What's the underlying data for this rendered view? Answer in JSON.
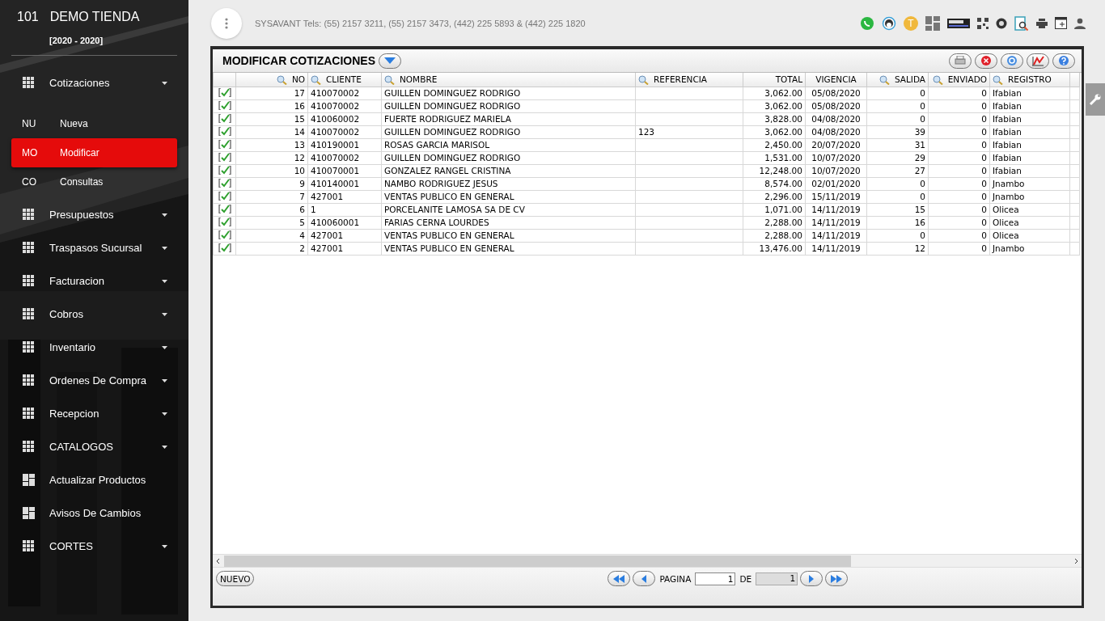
{
  "sidebar": {
    "store_number": "101",
    "store_name": "DEMO TIENDA",
    "period": "[2020 - 2020]",
    "items": [
      {
        "label": "Cotizaciones",
        "kind": "group",
        "children": [
          {
            "abbr": "NU",
            "label": "Nueva",
            "selected": false
          },
          {
            "abbr": "MO",
            "label": "Modificar",
            "selected": true
          },
          {
            "abbr": "CO",
            "label": "Consultas",
            "selected": false
          }
        ]
      },
      {
        "label": "Presupuestos",
        "kind": "group"
      },
      {
        "label": "Traspasos Sucursal",
        "kind": "group"
      },
      {
        "label": "Facturacion",
        "kind": "group"
      },
      {
        "label": "Cobros",
        "kind": "group"
      },
      {
        "label": "Inventario",
        "kind": "group"
      },
      {
        "label": "Ordenes De Compra",
        "kind": "group"
      },
      {
        "label": "Recepcion",
        "kind": "group"
      },
      {
        "label": "CATALOGOS",
        "kind": "group"
      },
      {
        "label": "Actualizar Productos",
        "kind": "link"
      },
      {
        "label": "Avisos De Cambios",
        "kind": "link"
      },
      {
        "label": "CORTES",
        "kind": "group"
      }
    ]
  },
  "topbar": {
    "contact": "SYSAVANT Tels: (55) 2157 3211, (55) 2157 3473, (442) 225 5893 & (442) 225 1820",
    "user_initial": "T"
  },
  "window": {
    "title": "MODIFICAR COTIZACIONES",
    "table": {
      "columns": [
        {
          "label": "NO",
          "filter": true,
          "kind": "number"
        },
        {
          "label": "CLIENTE",
          "filter": true,
          "kind": "text"
        },
        {
          "label": "NOMBRE",
          "filter": true,
          "kind": "text"
        },
        {
          "label": "REFERENCIA",
          "filter": true,
          "kind": "text"
        },
        {
          "label": "TOTAL",
          "filter": false,
          "kind": "number"
        },
        {
          "label": "VIGENCIA",
          "filter": false,
          "kind": "date"
        },
        {
          "label": "SALIDA",
          "filter": true,
          "kind": "number"
        },
        {
          "label": "ENVIADO",
          "filter": true,
          "kind": "number"
        },
        {
          "label": "REGISTRO",
          "filter": true,
          "kind": "text"
        }
      ],
      "rows": [
        {
          "checked": true,
          "cells": [
            "17",
            "410070002",
            "GUILLEN DOMINGUEZ RODRIGO",
            "",
            "3,062.00",
            "05/08/2020",
            "0",
            "0",
            "Ifabian"
          ]
        },
        {
          "checked": true,
          "cells": [
            "16",
            "410070002",
            "GUILLEN DOMINGUEZ RODRIGO",
            "",
            "3,062.00",
            "05/08/2020",
            "0",
            "0",
            "Ifabian"
          ]
        },
        {
          "checked": true,
          "cells": [
            "15",
            "410060002",
            "FUERTE RODRIGUEZ MARIELA",
            "",
            "3,828.00",
            "04/08/2020",
            "0",
            "0",
            "Ifabian"
          ]
        },
        {
          "checked": true,
          "cells": [
            "14",
            "410070002",
            "GUILLEN DOMINGUEZ RODRIGO",
            "123",
            "3,062.00",
            "04/08/2020",
            "39",
            "0",
            "Ifabian"
          ]
        },
        {
          "checked": true,
          "cells": [
            "13",
            "410190001",
            "ROSAS GARCIA MARISOL",
            "",
            "2,450.00",
            "20/07/2020",
            "31",
            "0",
            "Ifabian"
          ]
        },
        {
          "checked": true,
          "cells": [
            "12",
            "410070002",
            "GUILLEN DOMINGUEZ RODRIGO",
            "",
            "1,531.00",
            "10/07/2020",
            "29",
            "0",
            "Ifabian"
          ]
        },
        {
          "checked": true,
          "cells": [
            "10",
            "410070001",
            "GONZALEZ RANGEL CRISTINA",
            "",
            "12,248.00",
            "10/07/2020",
            "27",
            "0",
            "Ifabian"
          ]
        },
        {
          "checked": true,
          "cells": [
            "9",
            "410140001",
            "NAMBO RODRIGUEZ JESUS",
            "",
            "8,574.00",
            "02/01/2020",
            "0",
            "0",
            "Jnambo"
          ]
        },
        {
          "checked": true,
          "cells": [
            "7",
            "427001",
            "VENTAS PUBLICO EN GENERAL",
            "",
            "2,296.00",
            "15/11/2019",
            "0",
            "0",
            "Jnambo"
          ]
        },
        {
          "checked": true,
          "cells": [
            "6",
            "1",
            "PORCELANITE LAMOSA SA DE CV",
            "",
            "1,071.00",
            "14/11/2019",
            "15",
            "0",
            "Olicea"
          ]
        },
        {
          "checked": true,
          "cells": [
            "5",
            "410060001",
            "FARIAS CERNA LOURDES",
            "",
            "2,288.00",
            "14/11/2019",
            "16",
            "0",
            "Olicea"
          ]
        },
        {
          "checked": true,
          "cells": [
            "4",
            "427001",
            "VENTAS PUBLICO EN GENERAL",
            "",
            "2,288.00",
            "14/11/2019",
            "0",
            "0",
            "Olicea"
          ]
        },
        {
          "checked": true,
          "cells": [
            "2",
            "427001",
            "VENTAS PUBLICO EN GENERAL",
            "",
            "13,476.00",
            "14/11/2019",
            "12",
            "0",
            "Jnambo"
          ]
        }
      ]
    },
    "footer": {
      "new_button": "NUEVO",
      "page_label": "PAGINA",
      "page": "1",
      "of_label": "DE",
      "total_pages": "1"
    }
  }
}
